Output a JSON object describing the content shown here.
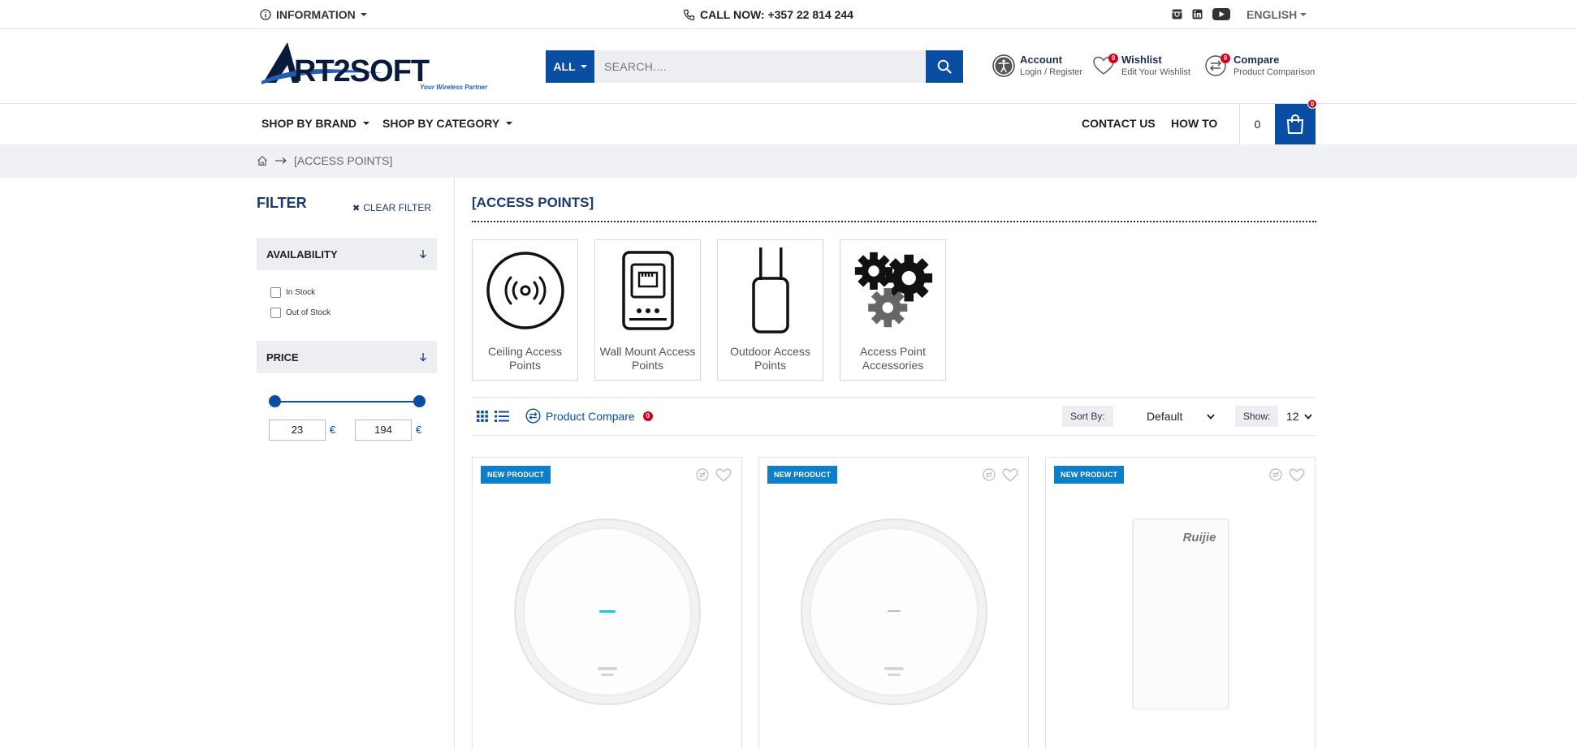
{
  "topbar": {
    "information_label": "INFORMATION",
    "call_label": "CALL NOW: +357 22 814 244",
    "language_label": "ENGLISH",
    "social_icons": [
      "instagram-icon",
      "linkedin-icon",
      "youtube-icon"
    ]
  },
  "header": {
    "logo_text": "RT2SOFT",
    "logo_tagline": "Your Wireless Partner",
    "search": {
      "category_label": "ALL",
      "placeholder": "SEARCH...."
    },
    "account": {
      "title": "Account",
      "subtitle": "Login / Register"
    },
    "wishlist": {
      "title": "Wishlist",
      "subtitle": "Edit Your Wishlist",
      "count": "0"
    },
    "compare": {
      "title": "Compare",
      "subtitle": "Product Comparison",
      "count": "0"
    }
  },
  "nav": {
    "shop_by_brand": "SHOP BY BRAND",
    "shop_by_category": "SHOP BY CATEGORY",
    "contact_us": "CONTACT US",
    "how_to": "HOW TO",
    "cart_total": "0",
    "cart_count": "0"
  },
  "breadcrumb": {
    "current": "[ACCESS POINTS]"
  },
  "sidebar": {
    "filter_title": "FILTER",
    "clear_filter": "CLEAR FILTER",
    "availability_title": "AVAILABILITY",
    "availability_options": [
      "In Stock",
      "Out of Stock"
    ],
    "price_title": "PRICE",
    "price_min": "23",
    "price_max": "194",
    "currency": "€"
  },
  "main": {
    "title": "[ACCESS POINTS]",
    "subcategories": [
      {
        "label": "Ceiling Access Points",
        "icon": "ceiling-access-point-icon"
      },
      {
        "label": "Wall Mount Access Points",
        "icon": "wall-mount-access-point-icon"
      },
      {
        "label": "Outdoor Access Points",
        "icon": "outdoor-access-point-icon"
      },
      {
        "label": "Access Point Accessories",
        "icon": "gears-icon"
      }
    ],
    "toolbar": {
      "product_compare": "Product Compare",
      "compare_count": "0",
      "sort_by_label": "Sort By:",
      "sort_value": "Default",
      "show_label": "Show:",
      "show_value": "12"
    },
    "products": [
      {
        "badge": "NEW PRODUCT"
      },
      {
        "badge": "NEW PRODUCT"
      },
      {
        "badge": "NEW PRODUCT",
        "brand_mark": "Ruijie"
      }
    ]
  },
  "colors": {
    "brand_blue": "#0a4ea3",
    "heading_navy": "#1d3a6e",
    "badge_blue": "#0d7ec8",
    "alert_red": "#d0021b"
  }
}
